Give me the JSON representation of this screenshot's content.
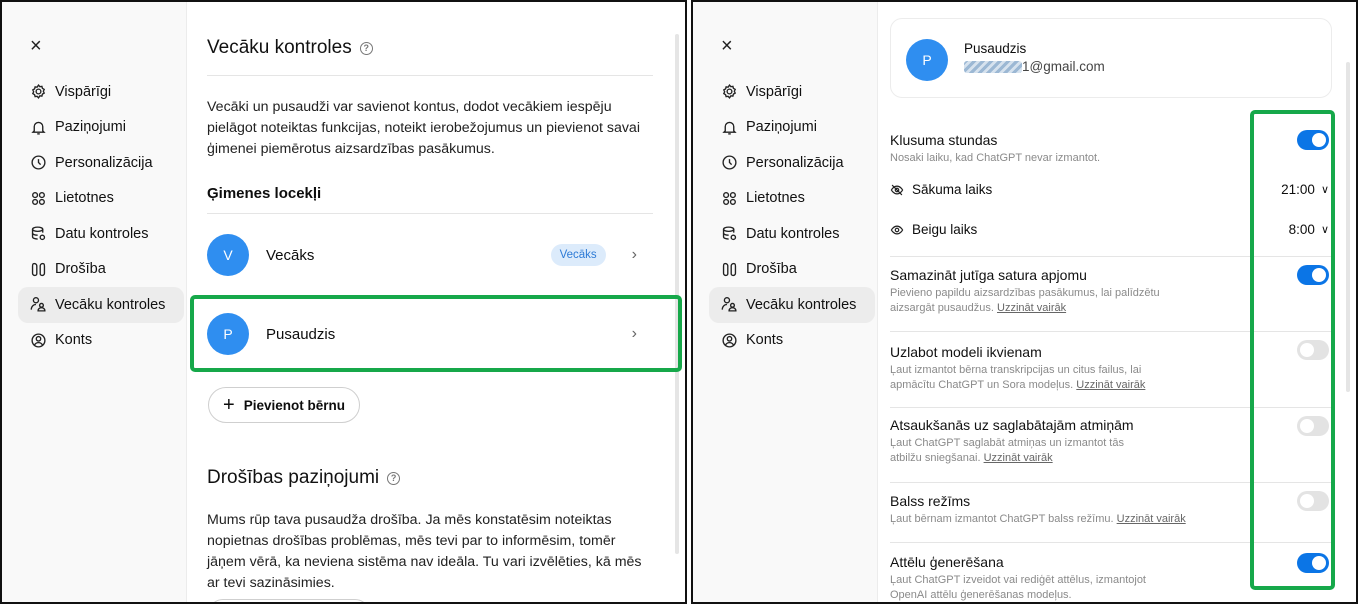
{
  "colors": {
    "accent": "#0b75e6",
    "avatar": "#2f8ef0",
    "highlight": "#16a84a",
    "badge_bg": "#dcebfb"
  },
  "sidebar": {
    "close": "×",
    "items": [
      {
        "label": "Vispārīgi",
        "icon": "gear-icon"
      },
      {
        "label": "Paziņojumi",
        "icon": "bell-icon"
      },
      {
        "label": "Personalizācija",
        "icon": "personalization-icon"
      },
      {
        "label": "Lietotnes",
        "icon": "apps-icon"
      },
      {
        "label": "Datu kontroles",
        "icon": "database-icon"
      },
      {
        "label": "Drošība",
        "icon": "shield-icon"
      },
      {
        "label": "Vecāku kontroles",
        "icon": "parent-icon"
      },
      {
        "label": "Konts",
        "icon": "account-icon"
      }
    ]
  },
  "left": {
    "title": "Vecāku kontroles",
    "intro": "Vecāki un pusaudži var savienot kontus, dodot vecākiem iespēju pielāgot noteiktas funkcijas, noteikt ierobežojumus un pievienot savai ģimenei piemērotus aizsardzības pasākumus.",
    "family_heading": "Ģimenes locekļi",
    "members": [
      {
        "initial": "V",
        "name": "Vecāks",
        "badge": "Vecāks"
      },
      {
        "initial": "P",
        "name": "Pusaudzis",
        "badge": ""
      }
    ],
    "add_child": "Pievienot bērnu",
    "safety_title": "Drošības paziņojumi",
    "safety_text": "Mums rūp tava pusaudža drošība. Ja mēs konstatēsim noteiktas nopietnas drošības problēmas, mēs tevi par to informēsim, tomēr jāņem vērā, ka neviena sistēma nav ideāla. Tu vari izvēlēties, kā mēs ar tevi sazināsimies."
  },
  "right": {
    "profile": {
      "initial": "P",
      "name": "Pusaudzis",
      "email": "1@gmail.com"
    },
    "quiet": {
      "title": "Klusuma stundas",
      "desc": "Nosaki laiku, kad ChatGPT nevar izmantot.",
      "on": true
    },
    "start": {
      "label": "Sākuma laiks",
      "value": "21:00"
    },
    "end": {
      "label": "Beigu laiks",
      "value": "8:00"
    },
    "settings": [
      {
        "title": "Samazināt jutīga satura apjomu",
        "desc": "Pievieno papildu aizsardzības pasākumus, lai palīdzētu aizsargāt pusaudžus.",
        "link": "Uzzināt vairāk",
        "on": true
      },
      {
        "title": "Uzlabot modeli ikvienam",
        "desc": "Ļaut izmantot bērna transkripcijas un citus failus, lai apmācītu ChatGPT un Sora modeļus.",
        "link": "Uzzināt vairāk",
        "on": false
      },
      {
        "title": "Atsaukšanās uz saglabātajām atmiņām",
        "desc": "Ļaut ChatGPT saglabāt atmiņas un izmantot tās atbilžu sniegšanai.",
        "link": "Uzzināt vairāk",
        "on": false
      },
      {
        "title": "Balss režīms",
        "desc": "Ļaut bērnam izmantot ChatGPT balss režīmu.",
        "link": "Uzzināt vairāk",
        "on": false
      },
      {
        "title": "Attēlu ģenerēšana",
        "desc": "Ļaut ChatGPT izveidot vai rediģēt attēlus, izmantojot OpenAI attēlu ģenerēšanas modeļus.",
        "link": "",
        "on": true
      }
    ]
  }
}
